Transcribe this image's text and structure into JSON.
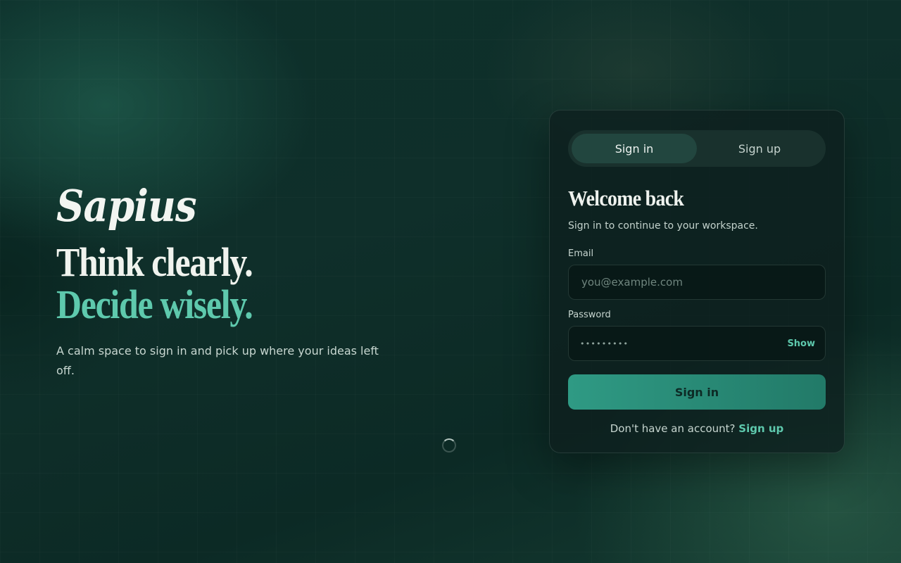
{
  "hero": {
    "brand": "Sapius",
    "headline_line1": "Think clearly.",
    "headline_line2": "Decide wisely.",
    "tagline": "A calm space to sign in and pick up where your ideas left off."
  },
  "auth_card": {
    "tabs": [
      {
        "label": "Sign in",
        "active": true
      },
      {
        "label": "Sign up",
        "active": false
      }
    ],
    "title": "Welcome back",
    "subtitle": "Sign in to continue to your workspace.",
    "email": {
      "label": "Email",
      "placeholder": "you@example.com",
      "value": ""
    },
    "password": {
      "label": "Password",
      "masked_value": "•••••••••",
      "toggle_label": "Show"
    },
    "submit_label": "Sign in",
    "footer_prompt": "Don't have an account?",
    "footer_link": "Sign up"
  },
  "loading_indicator": {
    "icon": "spinner-icon"
  },
  "colors": {
    "accent": "#5ec9ad",
    "button_start": "#2f9a84",
    "button_end": "#227a68",
    "background": "#0f2f2a"
  }
}
